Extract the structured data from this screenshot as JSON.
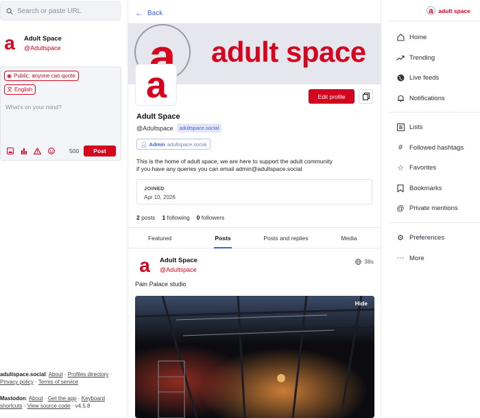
{
  "search": {
    "placeholder": "Search or paste URL",
    "icon": "search-icon"
  },
  "me": {
    "display_name": "Adult Space",
    "acct": "@Adultspace"
  },
  "composer": {
    "visibility": "Public, anyone can quote",
    "language": "English",
    "placeholder": "What's on your mind?",
    "char_count": "500",
    "post_label": "Post"
  },
  "footer": {
    "site": "adultspace.social",
    "site_links": [
      "About",
      "Profiles directory",
      "Privacy policy",
      "Terms of service"
    ],
    "mastodon": "Mastodon",
    "mastodon_links": [
      "About",
      "Get the app",
      "Keyboard shortcuts",
      "View source code"
    ],
    "version": "v4.5.8"
  },
  "profile": {
    "back_label": "Back",
    "banner_text": "adult space",
    "display_name": "Adult Space",
    "handle": "@Adultspace",
    "domain": "adultspace.social",
    "edit_label": "Edit profile",
    "role_label": "Admin",
    "role_domain": "adultspace.social",
    "bio_line1": "This is the home of adult space, we are here to support the adult community",
    "bio_line2": "if you have any queries you can email admin@adultspace.social",
    "joined_label": "JOINED",
    "joined_date": "Apr 10, 2026",
    "posts_count": "2",
    "posts_label": "posts",
    "following_count": "1",
    "following_label": "following",
    "followers_count": "0",
    "followers_label": "followers",
    "tabs": [
      "Featured",
      "Posts",
      "Posts and replies",
      "Media"
    ],
    "active_tab": "Posts"
  },
  "status": {
    "display_name": "Adult Space",
    "acct": "@Adultspace",
    "time": "38s",
    "text": "Pain Palace studio",
    "hide_label": "Hide"
  },
  "brand": {
    "text": "adult space"
  },
  "nav": {
    "group1": [
      {
        "label": "Home",
        "icon": "home-icon"
      },
      {
        "label": "Trending",
        "icon": "trending-icon"
      },
      {
        "label": "Live feeds",
        "icon": "globe-icon"
      },
      {
        "label": "Notifications",
        "icon": "bell-icon"
      }
    ],
    "group2": [
      {
        "label": "Lists",
        "icon": "list-icon"
      },
      {
        "label": "Followed hashtags",
        "icon": "hashtag-icon"
      },
      {
        "label": "Favorites",
        "icon": "star-icon"
      },
      {
        "label": "Bookmarks",
        "icon": "bookmark-icon"
      },
      {
        "label": "Private mentions",
        "icon": "at-icon"
      }
    ],
    "group3": [
      {
        "label": "Preferences",
        "icon": "gear-icon"
      },
      {
        "label": "More",
        "icon": "more-icon"
      }
    ]
  },
  "colors": {
    "accent": "#d4051f",
    "link": "#3c62d8",
    "banner_bg": "#e6e6ef"
  }
}
